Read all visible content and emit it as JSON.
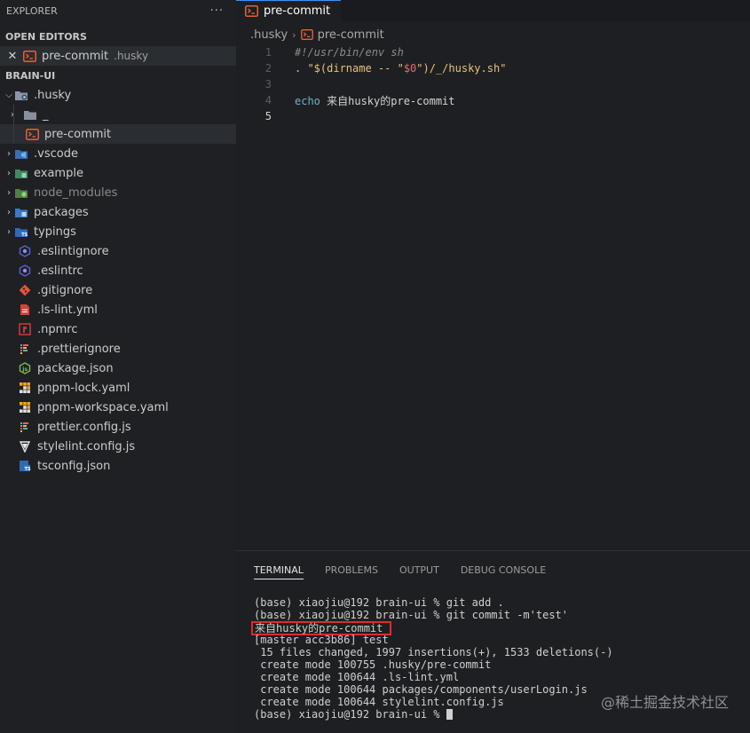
{
  "explorer": {
    "title": "EXPLORER",
    "more": "···",
    "open_editors_title": "OPEN EDITORS",
    "open_editor": {
      "name": "pre-commit",
      "folder": ".husky"
    },
    "project_title": "BRAIN-UI",
    "tree": [
      {
        "label": ".husky",
        "icon": "husky-folder-icon",
        "expanded": true
      },
      {
        "label": "_",
        "icon": "folder-icon"
      },
      {
        "label": "pre-commit",
        "icon": "shell-file-icon",
        "selected": true
      },
      {
        "label": ".vscode",
        "icon": "vscode-folder-icon"
      },
      {
        "label": "example",
        "icon": "example-folder-icon"
      },
      {
        "label": "node_modules",
        "icon": "node-modules-folder-icon"
      },
      {
        "label": "packages",
        "icon": "packages-folder-icon"
      },
      {
        "label": "typings",
        "icon": "ts-folder-icon"
      },
      {
        "label": ".eslintignore",
        "icon": "eslint-icon"
      },
      {
        "label": ".eslintrc",
        "icon": "eslint-icon"
      },
      {
        "label": ".gitignore",
        "icon": "git-icon"
      },
      {
        "label": ".ls-lint.yml",
        "icon": "yaml-file-icon"
      },
      {
        "label": ".npmrc",
        "icon": "npm-icon"
      },
      {
        "label": ".prettierignore",
        "icon": "prettier-icon"
      },
      {
        "label": "package.json",
        "icon": "nodejs-icon"
      },
      {
        "label": "pnpm-lock.yaml",
        "icon": "pnpm-icon"
      },
      {
        "label": "pnpm-workspace.yaml",
        "icon": "pnpm-icon"
      },
      {
        "label": "prettier.config.js",
        "icon": "prettier-icon"
      },
      {
        "label": "stylelint.config.js",
        "icon": "stylelint-icon"
      },
      {
        "label": "tsconfig.json",
        "icon": "tsconfig-icon"
      }
    ]
  },
  "editor": {
    "tab": "pre-commit",
    "breadcrumb": [
      ".husky",
      "pre-commit"
    ],
    "active_line": 5,
    "lines": {
      "n1": "1",
      "n2": "2",
      "n3": "3",
      "n4": "4",
      "n5": "5",
      "l1": "#!/usr/bin/env sh",
      "l2_a": ". \"$(dirname -- \"",
      "l2_b": "$0",
      "l2_c": "\")/_/husky.sh\"",
      "l4_kw": "echo",
      "l4_text": " 来自husky的pre-commit"
    }
  },
  "panel": {
    "tabs": [
      "TERMINAL",
      "PROBLEMS",
      "OUTPUT",
      "DEBUG CONSOLE"
    ],
    "active_tab": "TERMINAL",
    "terminal": [
      "(base) xiaojiu@192 brain-ui % git add .",
      "(base) xiaojiu@192 brain-ui % git commit -m'test'",
      "来自husky的pre-commit",
      "[master acc3b86] test",
      " 15 files changed, 1997 insertions(+), 1533 deletions(-)",
      " create mode 100755 .husky/pre-commit",
      " create mode 100644 .ls-lint.yml",
      " create mode 100644 packages/components/userLogin.js",
      " create mode 100644 stylelint.config.js",
      "(base) xiaojiu@192 brain-ui % "
    ]
  },
  "watermark": "@稀土掘金技术社区",
  "colors": {
    "highlight_box": "#e02b2b",
    "tab_accent": "#3794ff",
    "shell_icon": "#e2603a"
  }
}
